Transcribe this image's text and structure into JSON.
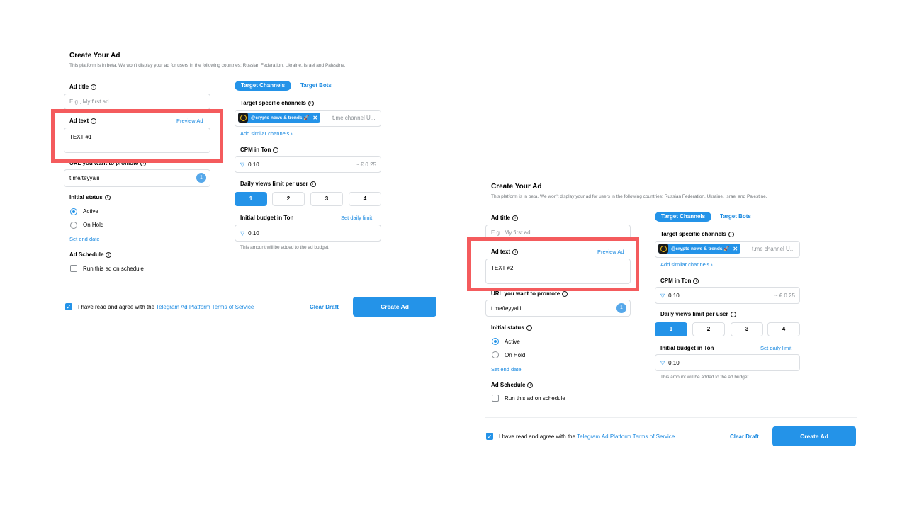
{
  "panels": [
    {
      "title": "Create Your Ad",
      "subtitle": "This platform is in beta. We won't display your ad for users in the following countries: Russian Federation, Ukraine, Israel and Palestine.",
      "ad_title": {
        "label": "Ad title",
        "placeholder": "E.g., My first ad"
      },
      "ad_text": {
        "label": "Ad text",
        "preview_link": "Preview Ad",
        "value": "TEXT #1"
      },
      "url": {
        "label": "URL you want to promote",
        "value": "t.me/teyyaiii",
        "badge": "1"
      },
      "initial_status": {
        "label": "Initial status",
        "options": [
          "Active",
          "On Hold"
        ],
        "selected": "Active"
      },
      "set_end_date": "Set end date",
      "ad_schedule": {
        "label": "Ad Schedule",
        "checkbox": "Run this ad on schedule"
      },
      "tabs": [
        "Target Channels",
        "Target Bots"
      ],
      "target_channels": {
        "label": "Target specific channels",
        "chip": "@crypto news & trends 🚀",
        "input_placeholder": "t.me channel U...",
        "add_similar": "Add similar channels ›"
      },
      "cpm": {
        "label": "CPM in Ton",
        "value": "0.10",
        "equiv": "~ € 0.25"
      },
      "daily_views": {
        "label": "Daily views limit per user",
        "options": [
          "1",
          "2",
          "3",
          "4"
        ],
        "selected": "1"
      },
      "budget": {
        "label": "Initial budget in Ton",
        "daily_limit_link": "Set daily limit",
        "value": "0.10",
        "note": "This amount will be added to the ad budget."
      },
      "footer": {
        "agree_text": "I have read and agree with the ",
        "terms_link": "Telegram Ad Platform Terms of Service",
        "clear_draft": "Clear Draft",
        "create_ad": "Create Ad"
      }
    },
    {
      "title": "Create Your Ad",
      "subtitle": "This platform is in beta. We won't display your ad for users in the following countries: Russian Federation, Ukraine, Israel and Palestine.",
      "ad_title": {
        "label": "Ad title",
        "placeholder": "E.g., My first ad"
      },
      "ad_text": {
        "label": "Ad text",
        "preview_link": "Preview Ad",
        "value": "TEXT #2"
      },
      "url": {
        "label": "URL you want to promote",
        "value": "t.me/teyyaiii",
        "badge": "1"
      },
      "initial_status": {
        "label": "Initial status",
        "options": [
          "Active",
          "On Hold"
        ],
        "selected": "Active"
      },
      "set_end_date": "Set end date",
      "ad_schedule": {
        "label": "Ad Schedule",
        "checkbox": "Run this ad on schedule"
      },
      "tabs": [
        "Target Channels",
        "Target Bots"
      ],
      "target_channels": {
        "label": "Target specific channels",
        "chip": "@crypto news & trends 🚀",
        "input_placeholder": "t.me channel U...",
        "add_similar": "Add similar channels ›"
      },
      "cpm": {
        "label": "CPM in Ton",
        "value": "0.10",
        "equiv": "~ € 0.25"
      },
      "daily_views": {
        "label": "Daily views limit per user",
        "options": [
          "1",
          "2",
          "3",
          "4"
        ],
        "selected": "1"
      },
      "budget": {
        "label": "Initial budget in Ton",
        "daily_limit_link": "Set daily limit",
        "value": "0.10",
        "note": "This amount will be added to the ad budget."
      },
      "footer": {
        "agree_text": "I have read and agree with the ",
        "terms_link": "Telegram Ad Platform Terms of Service",
        "clear_draft": "Clear Draft",
        "create_ad": "Create Ad"
      }
    }
  ],
  "colors": {
    "accent": "#2493e8",
    "highlight": "#f45b5d",
    "link": "#1a89e0"
  },
  "icons": [
    "info-icon",
    "check-icon",
    "ton-icon",
    "close-icon",
    "channel-avatar-icon"
  ]
}
